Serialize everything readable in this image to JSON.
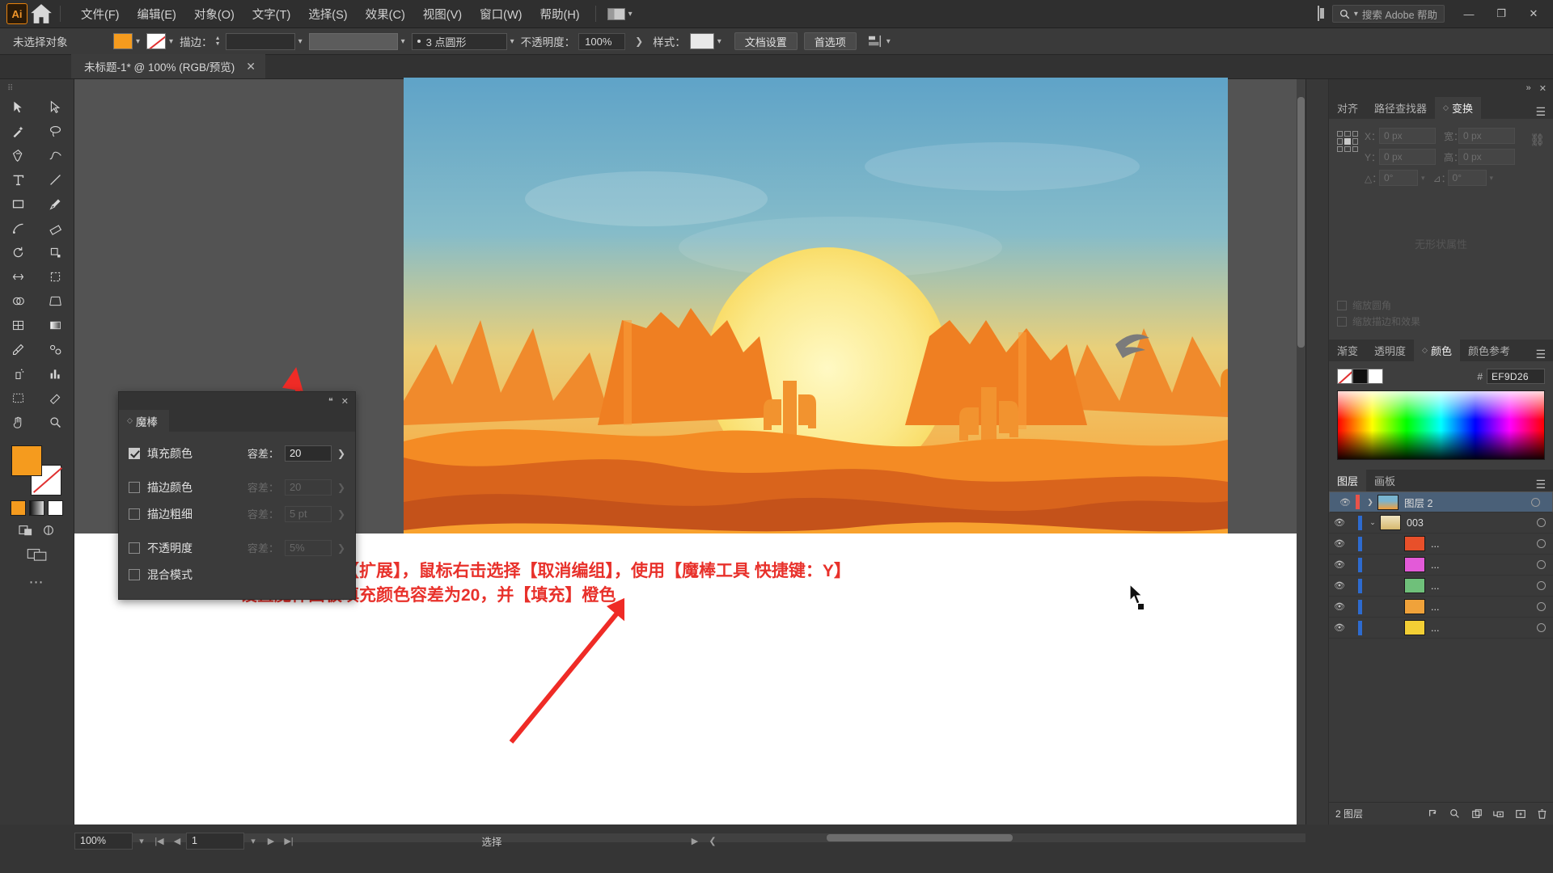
{
  "app": {
    "name": "Adobe Illustrator",
    "logo_text": "Ai"
  },
  "menubar": {
    "items": [
      "文件(F)",
      "编辑(E)",
      "对象(O)",
      "文字(T)",
      "选择(S)",
      "效果(C)",
      "视图(V)",
      "窗口(W)",
      "帮助(H)"
    ],
    "home_icon": "home-icon",
    "workspace_icon": "workspace-switcher-icon",
    "chevron": "▾",
    "search_placeholder": "搜索 Adobe 帮助",
    "search_icon": "search-icon",
    "panel_icon": "panel-toggle-icon",
    "window_minimize": "—",
    "window_restore": "❐",
    "window_close": "✕"
  },
  "controlbar": {
    "selection_status": "未选择对象",
    "fill_label": "fill-swatch",
    "fill_color": "#F59B1E",
    "stroke_label": "描边：",
    "stroke_weight": "",
    "stroke_profile": "3 点圆形",
    "opacity_label": "不透明度：",
    "opacity_value": "100%",
    "opacity_arrow": "❯",
    "style_label": "样式：",
    "doc_setup_button": "文档设置",
    "preferences_button": "首选项",
    "align_icon": "align-icon"
  },
  "tabbar": {
    "document_title": "未标题-1* @ 100% (RGB/预览)",
    "close_icon": "✕"
  },
  "toolbar": {
    "grip": "⠿",
    "tools": [
      "selection-tool",
      "direct-selection-tool",
      "magic-wand-tool",
      "lasso-tool",
      "pen-tool",
      "curvature-tool",
      "type-tool",
      "line-segment-tool",
      "rectangle-tool",
      "paintbrush-tool",
      "shaper-tool",
      "eraser-tool",
      "rotate-tool",
      "scale-tool",
      "width-tool",
      "free-transform-tool",
      "shape-builder-tool",
      "perspective-grid-tool",
      "mesh-tool",
      "gradient-tool",
      "eyedropper-tool",
      "blend-tool",
      "symbol-sprayer-tool",
      "column-graph-tool",
      "artboard-tool",
      "slice-tool",
      "hand-tool",
      "zoom-tool"
    ],
    "fill_color": "#F59B1E",
    "stroke_color": "#FFFFFF",
    "color_mode_icons": [
      "color-swatch-icon",
      "gradient-swatch-icon",
      "none-swatch-icon"
    ],
    "screen_mode_icons": [
      "drawing-mode-icon",
      "screen-mode-icon"
    ],
    "more_tools": "⋯"
  },
  "canvas": {
    "artwork_alt": "desert-sunset-illustration",
    "cursor_icon": "cursor-arrow",
    "annotation_line1": "选中图片点击【扩展】，鼠标右击选择【取消编组】，使用【魔棒工具 快捷键：Y】",
    "annotation_line2": "设置魔棒面板填充颜色容差为20，并【填充】橙色",
    "annotation_color": "#E8312B"
  },
  "magic_wand_panel": {
    "title": "魔棒",
    "collapse_icon": "collapse-icon",
    "header_icons": [
      "panel-collapse-icon",
      "panel-close-icon"
    ],
    "rows": [
      {
        "label": "填充颜色",
        "checked": true,
        "tol_label": "容差：",
        "tol_value": "20",
        "enabled": true
      },
      {
        "label": "描边颜色",
        "checked": false,
        "tol_label": "容差：",
        "tol_value": "20",
        "enabled": false
      },
      {
        "label": "描边粗细",
        "checked": false,
        "tol_label": "容差：",
        "tol_value": "5 pt",
        "enabled": false
      },
      {
        "label": "不透明度",
        "checked": false,
        "tol_label": "容差：",
        "tol_value": "5%",
        "enabled": false
      },
      {
        "label": "混合模式",
        "checked": false,
        "tol_label": "",
        "tol_value": "",
        "enabled": false
      }
    ],
    "expand_arrow": "❯"
  },
  "dock": {
    "transform": {
      "tabs": [
        {
          "label": "对齐",
          "active": false
        },
        {
          "label": "路径查找器",
          "active": false
        },
        {
          "label": "变换",
          "active": true
        }
      ],
      "menu_icon": "panel-menu-icon",
      "close_icon": "✕",
      "collapse_icon": "»",
      "fields": [
        {
          "key": "X：",
          "value": "0 px"
        },
        {
          "key": "Y：",
          "value": "0 px"
        },
        {
          "key": "宽：",
          "value": "0 px"
        },
        {
          "key": "高：",
          "value": "0 px"
        }
      ],
      "angle_label": "△：",
      "angle_value": "0°",
      "shear_label": "⊿：",
      "shear_value": "0°",
      "lock_icon": "link-broken-icon",
      "reference_point_icon": "reference-point-grid",
      "empty_text": "无形状属性",
      "checkbox_scale_corners": "缩放圆角",
      "checkbox_scale_strokes": "缩放描边和效果"
    },
    "color": {
      "tabs": [
        {
          "label": "渐变",
          "active": false
        },
        {
          "label": "透明度",
          "active": false
        },
        {
          "label": "颜色",
          "active": true
        },
        {
          "label": "颜色参考",
          "active": false
        }
      ],
      "menu_icon": "panel-menu-icon",
      "hex_label": "#",
      "hex_value": "EF9D26",
      "none_swatch": "none-swatch-icon",
      "spectrum": "color-spectrum-ramp"
    },
    "layers": {
      "tabs": [
        {
          "label": "图层",
          "active": true
        },
        {
          "label": "画板",
          "active": false
        }
      ],
      "menu_icon": "panel-menu-icon",
      "rows": [
        {
          "name": "图层 2",
          "selected": true,
          "indent": 0,
          "twirl": "❯",
          "thumb": "artwork-thumb",
          "bar": "#E8534A"
        },
        {
          "name": "003",
          "selected": false,
          "indent": 1,
          "twirl": "⌄",
          "thumb": "group-thumb",
          "bar": "#2D6BD0"
        },
        {
          "name": "...",
          "selected": false,
          "indent": 2,
          "twirl": "",
          "thumb": "path-thumb-red",
          "bar": "#2D6BD0"
        },
        {
          "name": "...",
          "selected": false,
          "indent": 2,
          "twirl": "",
          "thumb": "path-thumb-magenta",
          "bar": "#2D6BD0"
        },
        {
          "name": "...",
          "selected": false,
          "indent": 2,
          "twirl": "",
          "thumb": "path-thumb-green",
          "bar": "#2D6BD0"
        },
        {
          "name": "...",
          "selected": false,
          "indent": 2,
          "twirl": "",
          "thumb": "path-thumb-orange",
          "bar": "#2D6BD0"
        },
        {
          "name": "...",
          "selected": false,
          "indent": 2,
          "twirl": "",
          "thumb": "path-thumb-yellow",
          "bar": "#2D6BD0"
        }
      ],
      "footer_count": "2 图层",
      "footer_icons": [
        "locate-object-icon",
        "search-icon",
        "new-sublayer-icon",
        "make-clipping-mask-icon",
        "new-layer-icon",
        "delete-layer-icon"
      ]
    }
  },
  "statusbar": {
    "zoom_value": "100%",
    "zoom_chevron": "▾",
    "nav_first": "|◀",
    "nav_prev": "◀",
    "page_value": "1",
    "page_chevron": "▾",
    "nav_next": "▶",
    "nav_last": "▶|",
    "current_tool": "选择",
    "tool_arrow": "▶",
    "tool_chevron": "❮"
  }
}
